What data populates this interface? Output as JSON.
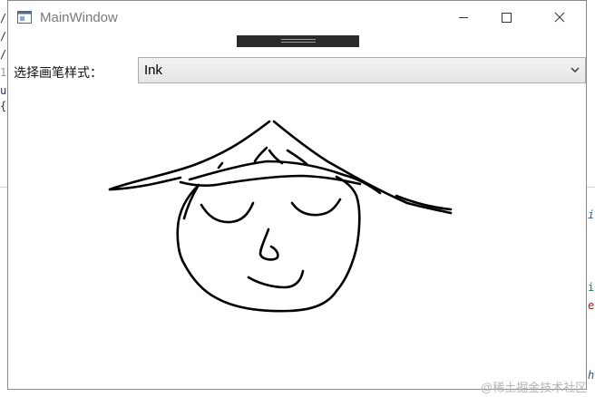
{
  "window": {
    "title": "MainWindow",
    "controls": [
      "minimize",
      "maximize",
      "close"
    ]
  },
  "toolbar": {
    "pen_style_label": "选择画笔样式：",
    "pen_style_value": "Ink"
  },
  "background": {
    "left_glyphs": [
      "/",
      "/",
      "/",
      "1",
      "u",
      "{"
    ],
    "right_glyphs": [
      "i",
      "i",
      "e",
      "h"
    ]
  },
  "watermark": "@稀土掘金技术社区"
}
